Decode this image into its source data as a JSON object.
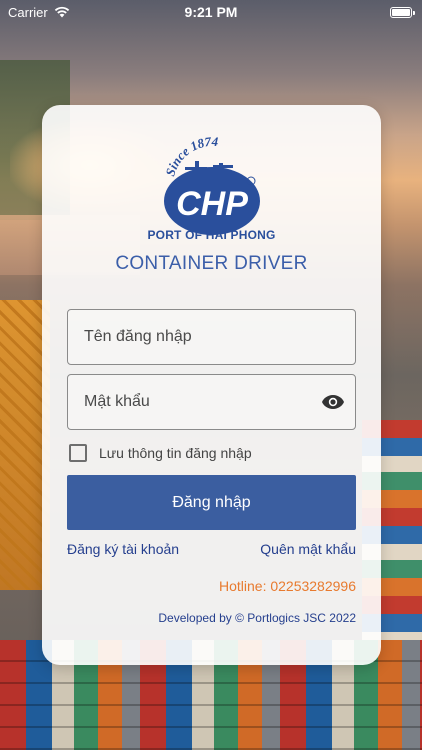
{
  "status_bar": {
    "carrier": "Carrier",
    "time": "9:21 PM",
    "battery_level": 1.0,
    "icons": [
      "wifi-icon",
      "battery-icon"
    ]
  },
  "logo": {
    "since_text": "Since 1874",
    "logo_letters": "CHP",
    "caption": "PORT OF HAI PHONG"
  },
  "app_title": "CONTAINER DRIVER",
  "form": {
    "username_placeholder": "Tên đăng nhập",
    "username_value": "",
    "password_placeholder": "Mật khẩu",
    "password_value": "",
    "password_toggle_icon": "eye-icon",
    "remember_label": "Lưu thông tin đăng nhập",
    "remember_checked": false,
    "login_label": "Đăng nhập"
  },
  "links": {
    "register": "Đăng ký tài khoản",
    "forgot_password": "Quên mật khẩu"
  },
  "hotline": "Hotline: 02253282996",
  "developer": "Developed by © Portlogics JSC 2022",
  "colors": {
    "primary": "#3b5ea0",
    "title": "#3b5ea9",
    "link": "#253f8e",
    "hotline": "#e87a2e",
    "logo_blue": "#2a4f9c"
  }
}
